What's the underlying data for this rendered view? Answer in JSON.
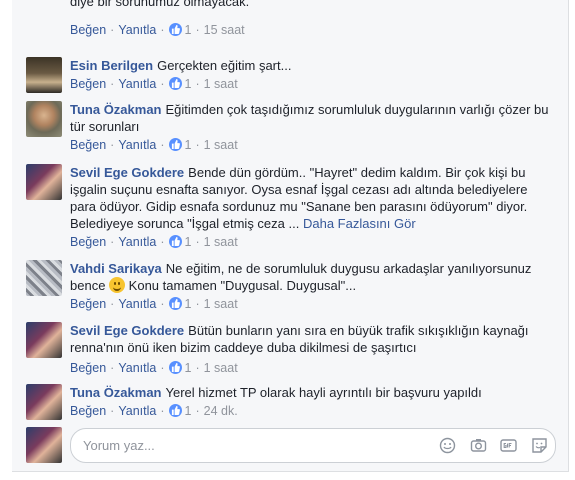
{
  "labels": {
    "like": "Beğen",
    "reply": "Yanıtla",
    "separator": "·"
  },
  "comments": [
    {
      "author": "",
      "text": "diye bir sorunumuz olmayacak.",
      "more": "",
      "likes": "1",
      "time": "15 saat"
    },
    {
      "author": "Esin Berilgen",
      "text": "Gerçekten eğitim şart...",
      "more": "",
      "likes": "1",
      "time": "1 saat"
    },
    {
      "author": "Tuna Özakman",
      "text": "Eğitimden çok taşıdığımız sorumluluk duygularının varlığı çözer bu tür sorunları",
      "more": "",
      "likes": "1",
      "time": "1 saat"
    },
    {
      "author": "Sevil Ege Gokdere",
      "text": "Bende dün gördüm.. \"Hayret\" dedim kaldım. Bir çok kişi bu işgalin suçunu esnafta sanıyor. Oysa esnaf İşgal cezası adı altında belediyelere para ödüyor. Gidip esnafa sordunuz mu \"Sanane ben parasını ödüyorum\" diyor. Belediyeye sorunca \"İşgal etmiş ceza ...",
      "more": "Daha Fazlasını Gör",
      "likes": "1",
      "time": "1 saat"
    },
    {
      "author": "Vahdi Sarikaya",
      "text_before": "Ne eğitim, ne de sorumluluk duygusu arkadaşlar yanılıyorsunuz bence",
      "text": "Konu tamamen \"Duygusal. Duygusal\"...",
      "more": "",
      "likes": "1",
      "time": "1 saat"
    },
    {
      "author": "Sevil Ege Gokdere",
      "text": "Bütün bunların yanı sıra en büyük trafik sıkışıklığın kaynağı renna'nın önü iken bizim caddeye duba dikilmesi de şaşırtıcı",
      "more": "",
      "likes": "1",
      "time": "1 saat"
    },
    {
      "author": "Tuna Özakman",
      "text": "Yerel hizmet TP olarak hayli ayrıntılı bir başvuru yapıldı",
      "more": "",
      "likes": "1",
      "time": "24 dk."
    }
  ],
  "composer": {
    "placeholder": "Yorum yaz..."
  },
  "icons": {
    "like": "thumbs-up-icon",
    "emoji": "smiley-icon",
    "camera": "camera-icon",
    "gif": "gif-icon",
    "sticker": "sticker-icon"
  },
  "colors": {
    "link": "#365899",
    "like_badge": "#5890ff",
    "meta": "#90949c"
  }
}
